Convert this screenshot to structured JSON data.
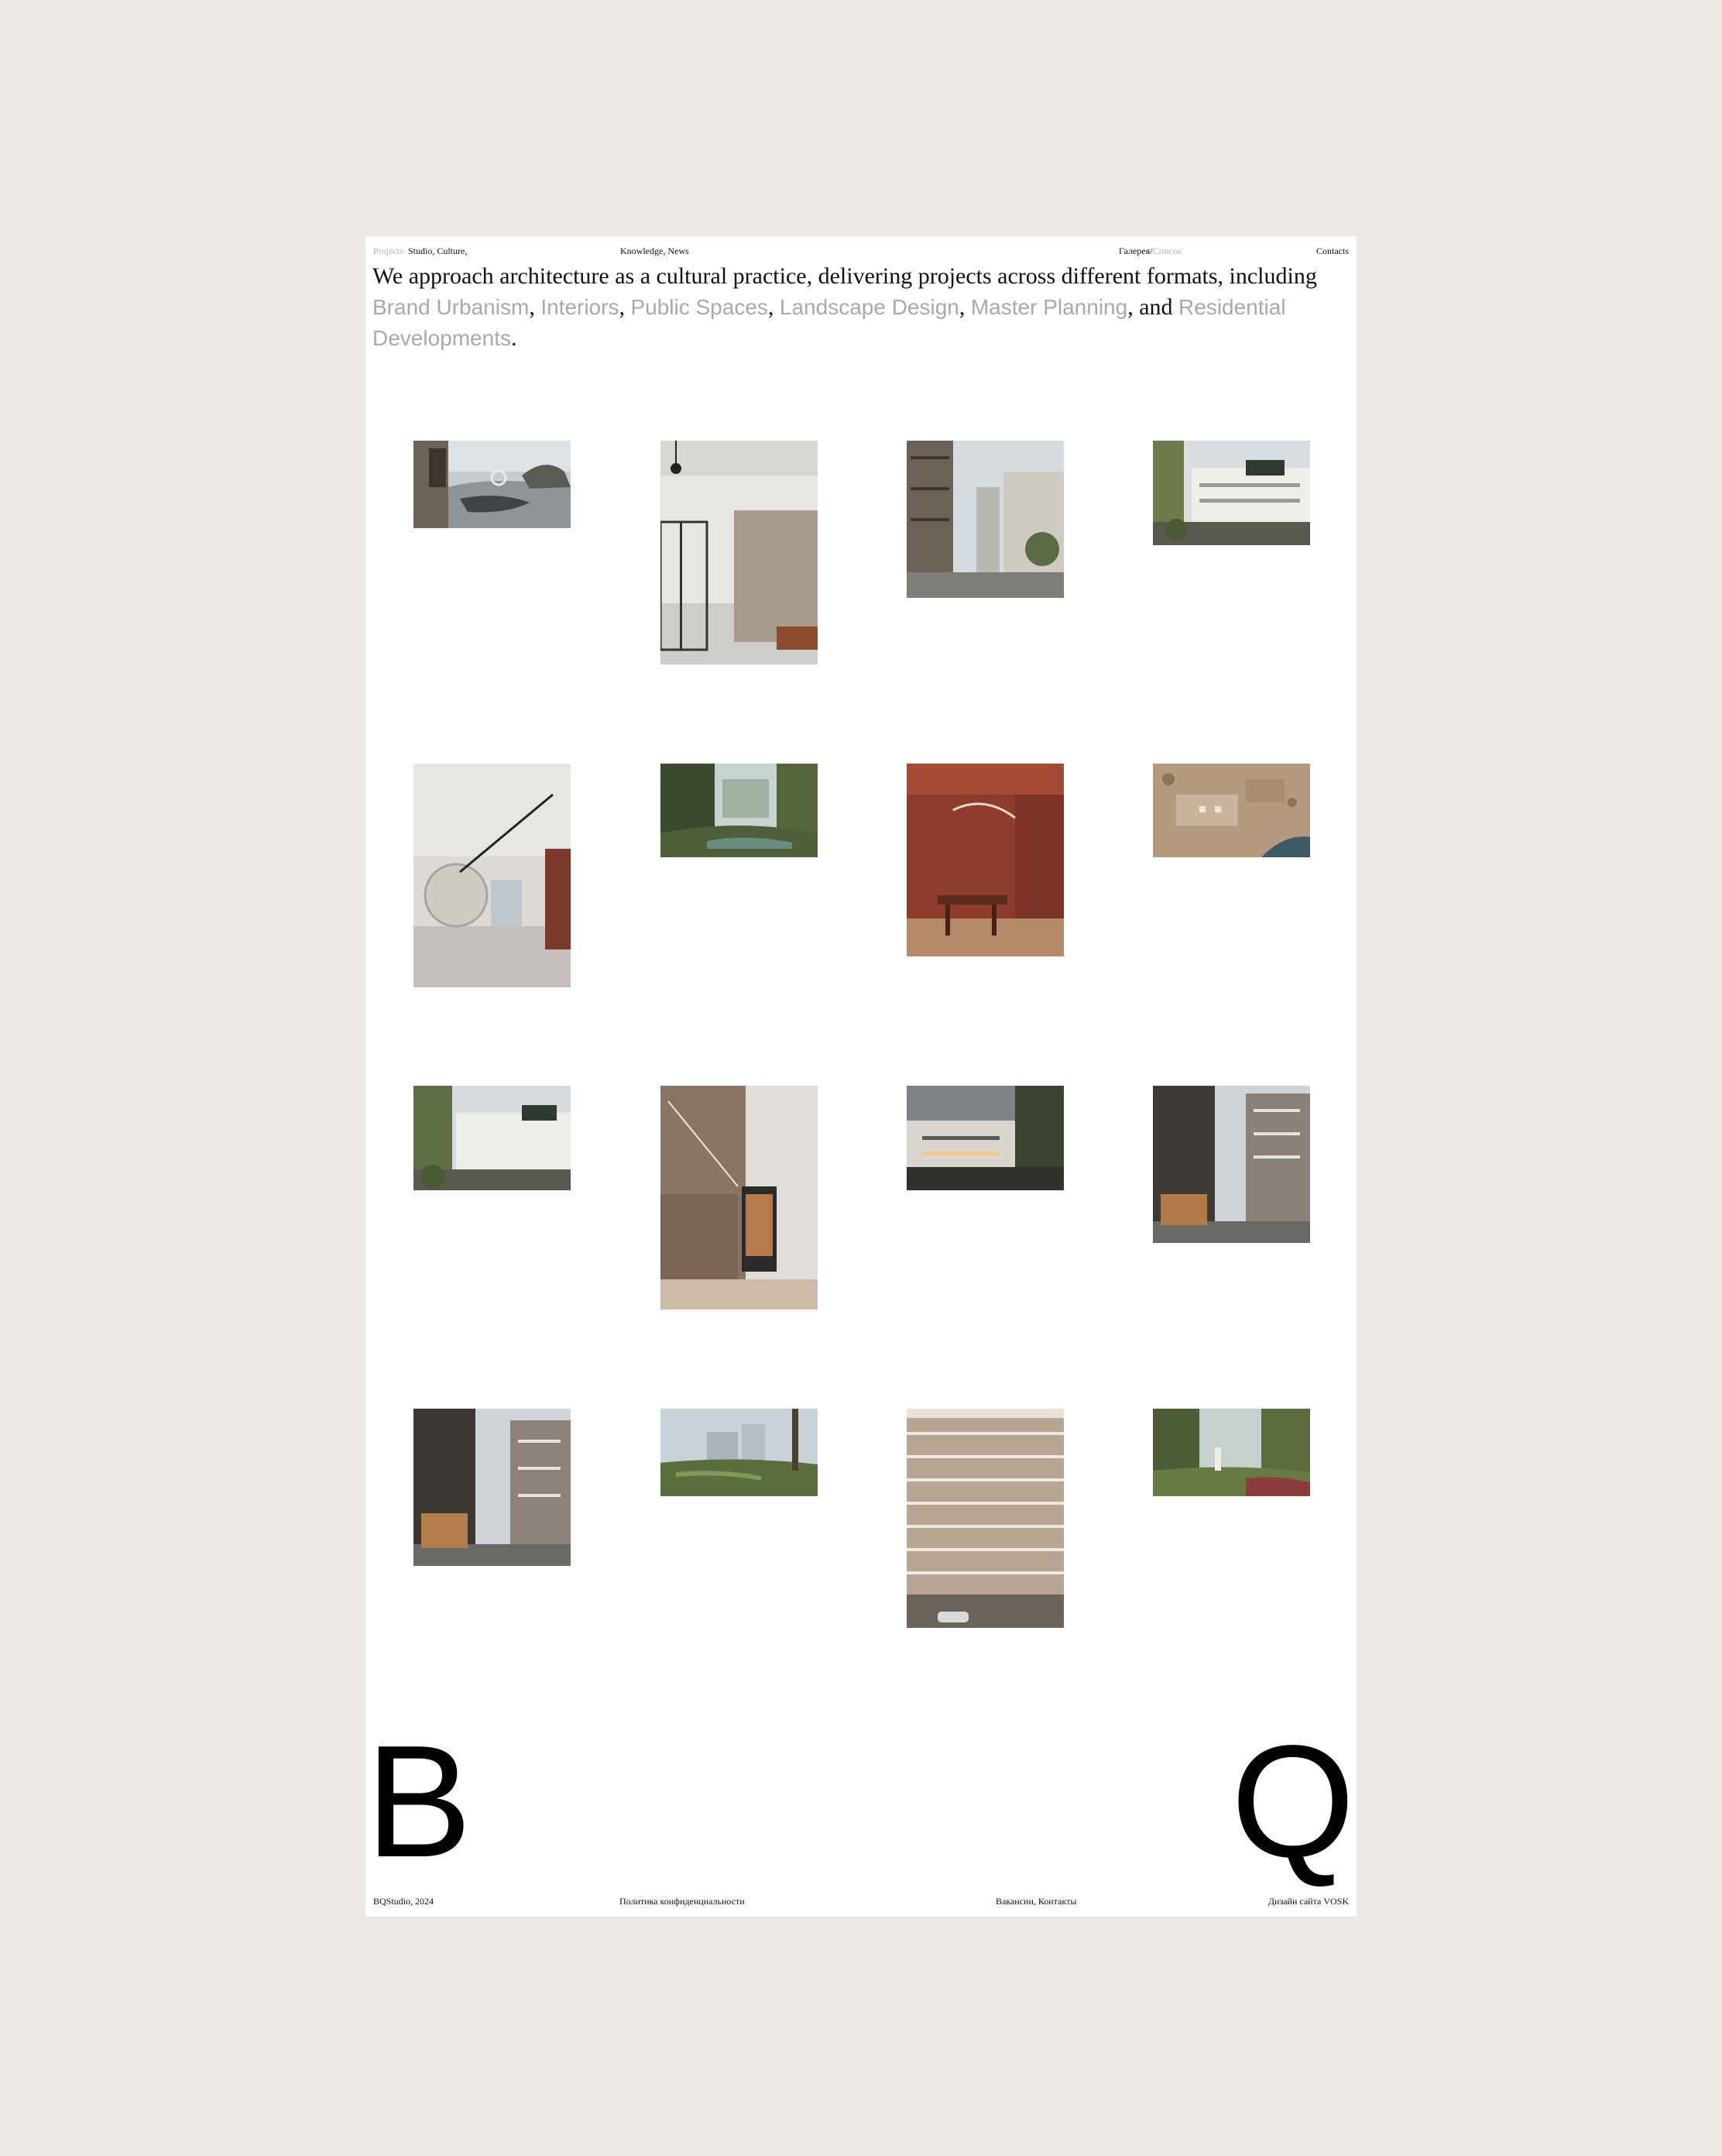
{
  "nav": {
    "projects_label": "Projects:",
    "projects_items": [
      "Studio,",
      "Culture,"
    ],
    "knowledge_items": [
      "Knowledge,",
      "News"
    ],
    "view_active": "Галерея",
    "view_separator": "/",
    "view_inactive": "Список",
    "contacts": "Contacts"
  },
  "intro": {
    "text_start": "We approach architecture as a cultural practice, delivering projects across different formats, including",
    "tags": [
      "Brand Urbanism",
      "Interiors",
      "Public Spaces",
      "Landscape Design",
      "Master Planning",
      "Residential Developments"
    ],
    "sep": ",",
    "and": ", and",
    "end": "."
  },
  "gallery": [
    {
      "name": "lake-villa-render",
      "icon": "landscape"
    },
    {
      "name": "lobby-interior-render",
      "icon": "interior"
    },
    {
      "name": "street-towers-render",
      "icon": "street"
    },
    {
      "name": "white-townhouses-render",
      "icon": "building"
    },
    {
      "name": "white-gallery-interior-render",
      "icon": "interior"
    },
    {
      "name": "forest-park-render",
      "icon": "forest"
    },
    {
      "name": "red-cafe-interior-render",
      "icon": "interior"
    },
    {
      "name": "masterplan-model-render",
      "icon": "aerial"
    },
    {
      "name": "townhouses-park-render",
      "icon": "building"
    },
    {
      "name": "kitchen-vending-interior-render",
      "icon": "interior"
    },
    {
      "name": "evening-townhouses-render",
      "icon": "building"
    },
    {
      "name": "residential-street-render",
      "icon": "street"
    },
    {
      "name": "residential-street-2-render",
      "icon": "street"
    },
    {
      "name": "riverside-meadow-render",
      "icon": "landscape"
    },
    {
      "name": "facade-elevation-render",
      "icon": "facade"
    },
    {
      "name": "garden-courtyard-render",
      "icon": "garden"
    }
  ],
  "logo": {
    "left": "B",
    "right": "Q"
  },
  "footer": {
    "copyright": "BQStudio, 2024",
    "privacy": "Политика конфиденциальности",
    "jobs_contacts": "Вакансии, Контакты",
    "design_credit": "Дизайн сайта VOSK"
  },
  "colors": {
    "background": "#ebe8e5",
    "page": "#ffffff",
    "muted_text": "#a9a9a9"
  }
}
